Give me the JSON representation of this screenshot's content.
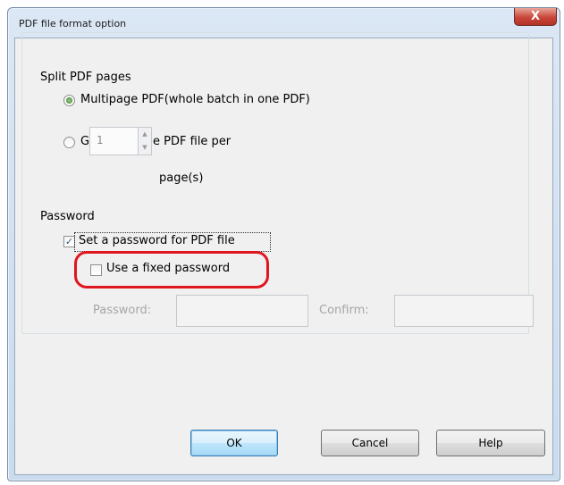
{
  "window": {
    "title": "PDF file format option",
    "close_label": "X"
  },
  "split_group": {
    "title": "Split PDF pages",
    "multipage_label": "Multipage PDF(whole batch in one PDF)",
    "multipage_checked": true,
    "per_page_label": "Generate one PDF file per",
    "per_page_checked": false,
    "pages_value": "1",
    "pages_unit": "page(s)"
  },
  "password_group": {
    "title": "Password",
    "set_password_label": "Set a password for PDF file",
    "set_password_checked": true,
    "fixed_password_label": "Use a fixed password",
    "fixed_password_checked": false,
    "password_label": "Password:",
    "password_value": "",
    "confirm_label": "Confirm:",
    "confirm_value": ""
  },
  "buttons": {
    "ok": "OK",
    "cancel": "Cancel",
    "help": "Help"
  },
  "colors": {
    "highlight": "#e0161f",
    "disabled_text": "#a6a6a6"
  }
}
